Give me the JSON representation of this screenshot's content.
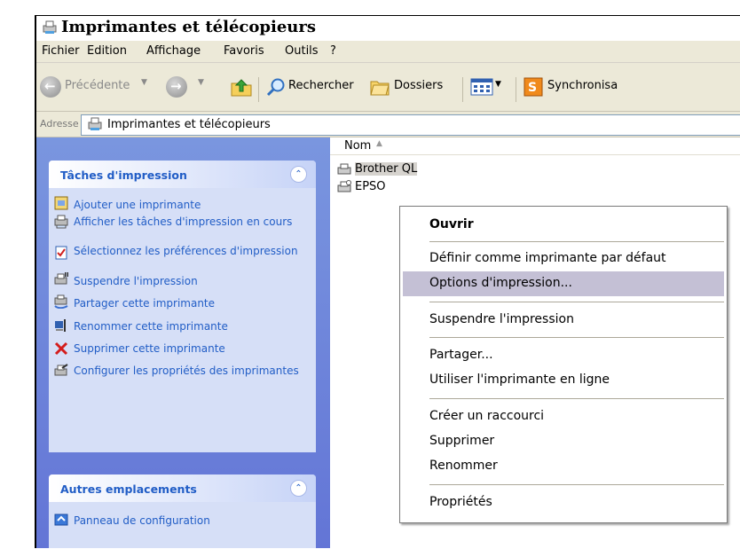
{
  "window": {
    "title": "Imprimantes et télécopieurs"
  },
  "menu": [
    "Fichier",
    "Edition",
    "Affichage",
    "Favoris",
    "Outils",
    "?"
  ],
  "toolbar": {
    "back_label": "Précédente",
    "search_label": "Rechercher",
    "folders_label": "Dossiers",
    "sync_label": "Synchronisa"
  },
  "address": {
    "label": "Adresse",
    "value": "Imprimantes et télécopieurs"
  },
  "print_tasks": {
    "title": "Tâches d'impression",
    "items": [
      "Ajouter une imprimante",
      "Afficher les tâches d'impression en cours",
      "Sélectionnez les préférences d'impression",
      "Suspendre l'impression",
      "Partager cette imprimante",
      "Renommer cette imprimante",
      "Supprimer cette imprimante",
      "Configurer les propriétés des imprimantes"
    ]
  },
  "other_places": {
    "title": "Autres emplacements",
    "items": [
      "Panneau de configuration"
    ]
  },
  "list": {
    "column_name": "Nom",
    "items": [
      "Brother QL",
      "EPSO"
    ]
  },
  "context_menu": {
    "items": [
      "Ouvrir",
      "Définir comme imprimante par défaut",
      "Options d'impression...",
      "Suspendre l'impression",
      "Partager...",
      "Utiliser l'imprimante en ligne",
      "Créer un raccourci",
      "Supprimer",
      "Renommer",
      "Propriétés"
    ],
    "highlighted_index": 2
  },
  "colors": {
    "pane_blue": "#6375d6",
    "task_text": "#215dc6",
    "menu_bg": "#ece9d8",
    "highlight": "#c4c0d5"
  }
}
